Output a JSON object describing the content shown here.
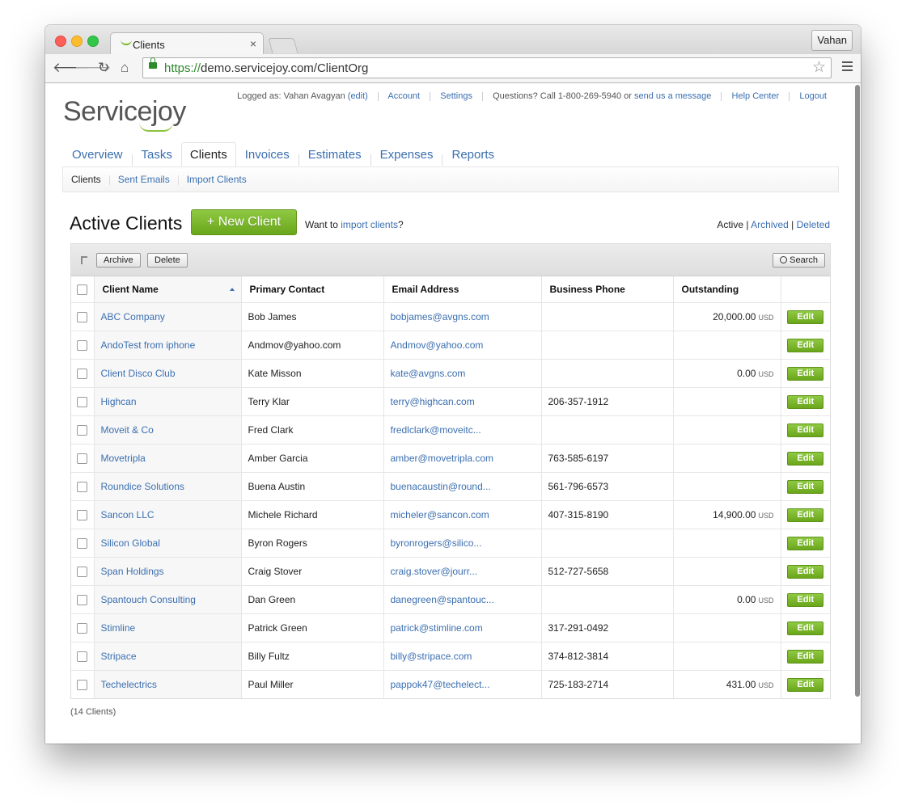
{
  "browser": {
    "tab_title": "Clients",
    "tab_close": "×",
    "user_button": "Vahan",
    "url_scheme": "https://",
    "url_rest": "demo.servicejoy.com/ClientOrg",
    "back_glyph": "🡐",
    "forward_glyph": "🡒",
    "reload_glyph": "↻",
    "home_glyph": "⌂",
    "star_glyph": "☆"
  },
  "header": {
    "logo": "Servicejoy",
    "logged_as_prefix": "Logged as:",
    "user_name": "Vahan Avagyan",
    "edit_link": "(edit)",
    "account": "Account",
    "settings": "Settings",
    "questions_text": "Questions? Call 1-800-269-5940 or",
    "message_link": "send us a message",
    "help": "Help Center",
    "logout": "Logout"
  },
  "main_tabs": [
    "Overview",
    "Tasks",
    "Clients",
    "Invoices",
    "Estimates",
    "Expenses",
    "Reports"
  ],
  "active_main_tab": "Clients",
  "sub_nav": [
    "Clients",
    "Sent Emails",
    "Import Clients"
  ],
  "content": {
    "title": "Active Clients",
    "new_client": "+ New Client",
    "want_text": "Want to",
    "import_link": "import clients",
    "want_suffix": "?",
    "filter_active": "Active",
    "filter_archived": "Archived",
    "filter_deleted": "Deleted",
    "archive": "Archive",
    "delete": "Delete",
    "search": "Search",
    "count": "(14 Clients)"
  },
  "table": {
    "columns": [
      "Client Name",
      "Primary Contact",
      "Email Address",
      "Business Phone",
      "Outstanding"
    ],
    "edit_label": "Edit",
    "currency": "USD",
    "rows": [
      {
        "name": "ABC Company",
        "contact": "Bob James",
        "email": "bobjames@avgns.com",
        "phone": "",
        "outstanding": "20,000.00"
      },
      {
        "name": "AndoTest from iphone",
        "contact": "Andmov@yahoo.com",
        "email": "Andmov@yahoo.com",
        "phone": "",
        "outstanding": ""
      },
      {
        "name": "Client Disco Club",
        "contact": "Kate Misson",
        "email": "kate@avgns.com",
        "phone": "",
        "outstanding": "0.00"
      },
      {
        "name": "Highcan",
        "contact": "Terry Klar",
        "email": "terry@highcan.com",
        "phone": "206-357-1912",
        "outstanding": ""
      },
      {
        "name": "Moveit & Co",
        "contact": "Fred Clark",
        "email": "fredlclark@moveitc...",
        "phone": "",
        "outstanding": ""
      },
      {
        "name": "Movetripla",
        "contact": "Amber Garcia",
        "email": "amber@movetripla.com",
        "phone": "763-585-6197",
        "outstanding": ""
      },
      {
        "name": "Roundice Solutions",
        "contact": "Buena Austin",
        "email": "buenacaustin@round...",
        "phone": "561-796-6573",
        "outstanding": ""
      },
      {
        "name": "Sancon LLC",
        "contact": "Michele Richard",
        "email": "micheler@sancon.com",
        "phone": "407-315-8190",
        "outstanding": "14,900.00"
      },
      {
        "name": "Silicon Global",
        "contact": "Byron Rogers",
        "email": "byronrogers@silico...",
        "phone": "",
        "outstanding": ""
      },
      {
        "name": "Span Holdings",
        "contact": "Craig Stover",
        "email": "craig.stover@jourr...",
        "phone": "512-727-5658",
        "outstanding": ""
      },
      {
        "name": "Spantouch Consulting",
        "contact": "Dan Green",
        "email": "danegreen@spantouc...",
        "phone": "",
        "outstanding": "0.00"
      },
      {
        "name": "Stimline",
        "contact": "Patrick Green",
        "email": "patrick@stimline.com",
        "phone": "317-291-0492",
        "outstanding": ""
      },
      {
        "name": "Stripace",
        "contact": "Billy Fultz",
        "email": "billy@stripace.com",
        "phone": "374-812-3814",
        "outstanding": ""
      },
      {
        "name": "Techelectrics",
        "contact": "Paul Miller",
        "email": "pappok47@techelect...",
        "phone": "725-183-2714",
        "outstanding": "431.00"
      }
    ]
  },
  "colors": {
    "link": "#3b6fb0",
    "button_green": "#7ab51d"
  }
}
